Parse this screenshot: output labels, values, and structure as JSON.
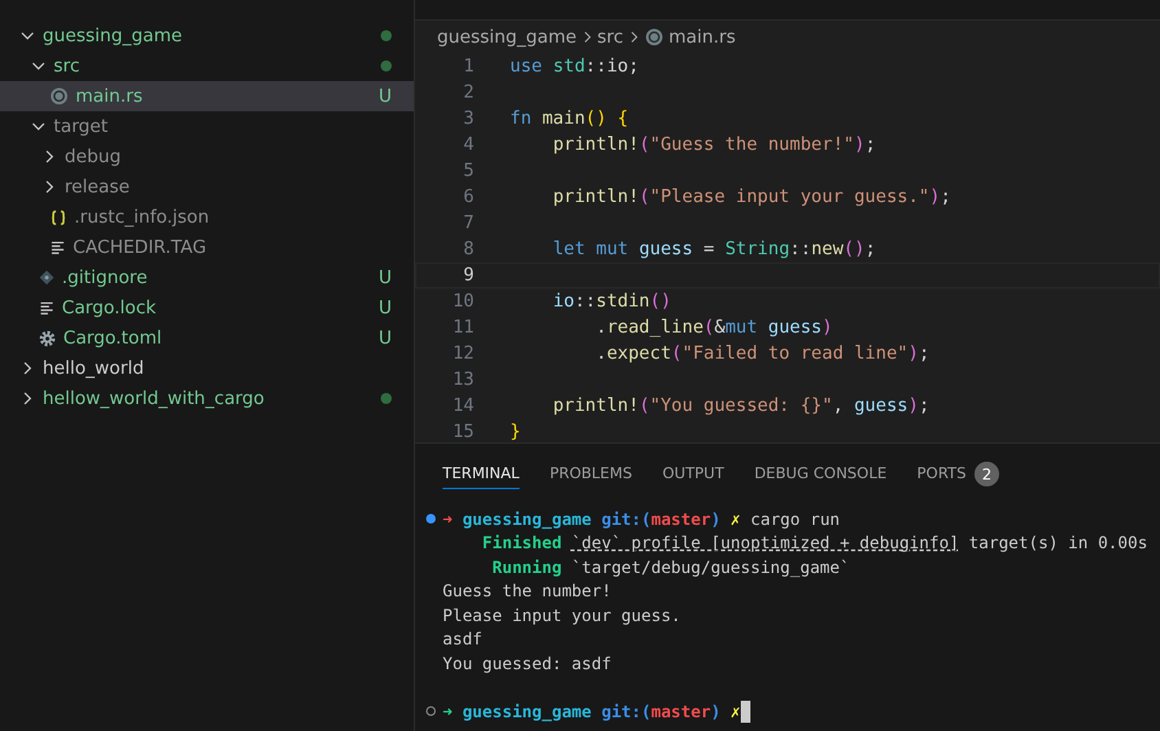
{
  "explorer": {
    "tree": [
      {
        "name": "guessing_game",
        "kind": "folder",
        "expanded": true,
        "untracked": true,
        "ignored": false,
        "dot": true,
        "selected": false,
        "children": [
          {
            "name": "src",
            "kind": "folder",
            "expanded": true,
            "untracked": true,
            "ignored": false,
            "dot": true,
            "selected": false,
            "children": [
              {
                "name": "main.rs",
                "kind": "rust",
                "untracked": true,
                "ignored": false,
                "badge": "U",
                "selected": true
              }
            ]
          },
          {
            "name": "target",
            "kind": "folder",
            "expanded": true,
            "untracked": false,
            "ignored": true,
            "selected": false,
            "children": [
              {
                "name": "debug",
                "kind": "folder",
                "expanded": false,
                "untracked": false,
                "ignored": true,
                "selected": false
              },
              {
                "name": "release",
                "kind": "folder",
                "expanded": false,
                "untracked": false,
                "ignored": true,
                "selected": false
              },
              {
                "name": ".rustc_info.json",
                "kind": "json",
                "untracked": false,
                "ignored": true,
                "selected": false
              },
              {
                "name": "CACHEDIR.TAG",
                "kind": "text",
                "untracked": false,
                "ignored": true,
                "selected": false
              }
            ]
          },
          {
            "name": ".gitignore",
            "kind": "git",
            "untracked": true,
            "ignored": false,
            "badge": "U",
            "selected": false
          },
          {
            "name": "Cargo.lock",
            "kind": "text",
            "untracked": true,
            "ignored": false,
            "badge": "U",
            "selected": false
          },
          {
            "name": "Cargo.toml",
            "kind": "config",
            "untracked": true,
            "ignored": false,
            "badge": "U",
            "selected": false
          }
        ]
      },
      {
        "name": "hello_world",
        "kind": "folder",
        "expanded": false,
        "untracked": false,
        "ignored": false,
        "selected": false
      },
      {
        "name": "hellow_world_with_cargo",
        "kind": "folder",
        "expanded": false,
        "untracked": true,
        "ignored": false,
        "dot": true,
        "selected": false
      }
    ]
  },
  "breadcrumbs": [
    "guessing_game",
    "src",
    "main.rs"
  ],
  "code": [
    {
      "n": "1",
      "current": false,
      "text": "use std::io;"
    },
    {
      "n": "2",
      "current": false
    },
    {
      "n": "3",
      "current": false,
      "text": "fn main() {"
    },
    {
      "n": "4",
      "current": false,
      "text": "    println!(\"Guess the number!\");"
    },
    {
      "n": "5",
      "current": false
    },
    {
      "n": "6",
      "current": false,
      "text": "    println!(\"Please input your guess.\");"
    },
    {
      "n": "7",
      "current": false
    },
    {
      "n": "8",
      "current": false,
      "text": "    let mut guess = String::new();"
    },
    {
      "n": "9",
      "current": true
    },
    {
      "n": "10",
      "current": false,
      "text": "    io::stdin()"
    },
    {
      "n": "11",
      "current": false,
      "text": "        .read_line(&mut guess)"
    },
    {
      "n": "12",
      "current": false,
      "text": "        .expect(\"Failed to read line\");"
    },
    {
      "n": "13",
      "current": false
    },
    {
      "n": "14",
      "current": false,
      "text": "    println!(\"You guessed: {}\", guess);"
    },
    {
      "n": "15",
      "current": false,
      "text": "}"
    }
  ],
  "panel_tabs": [
    {
      "label": "TERMINAL",
      "selected": true
    },
    {
      "label": "PROBLEMS",
      "selected": false
    },
    {
      "label": "OUTPUT",
      "selected": false
    },
    {
      "label": "DEBUG CONSOLE",
      "selected": false
    },
    {
      "label": "PORTS",
      "selected": false,
      "badge": "2"
    }
  ],
  "terminal": [
    {
      "kind": "prompt",
      "succeeded": true,
      "text": "➜ guessing_game git:(master) ✗ cargo run"
    },
    {
      "kind": "status",
      "text": "    Finished `dev` profile [unoptimized + debuginfo] target(s) in 0.00s"
    },
    {
      "kind": "status",
      "text": "     Running `target/debug/guessing_game`"
    },
    {
      "kind": "output",
      "text": "Guess the number!"
    },
    {
      "kind": "output",
      "text": "Please input your guess."
    },
    {
      "kind": "output",
      "text": "asdf"
    },
    {
      "kind": "output",
      "text": "You guessed: asdf"
    },
    {
      "kind": "blank"
    },
    {
      "kind": "prompt",
      "succeeded": false,
      "cursor": true,
      "text": "➜ guessing_game git:(master) ✗"
    }
  ]
}
